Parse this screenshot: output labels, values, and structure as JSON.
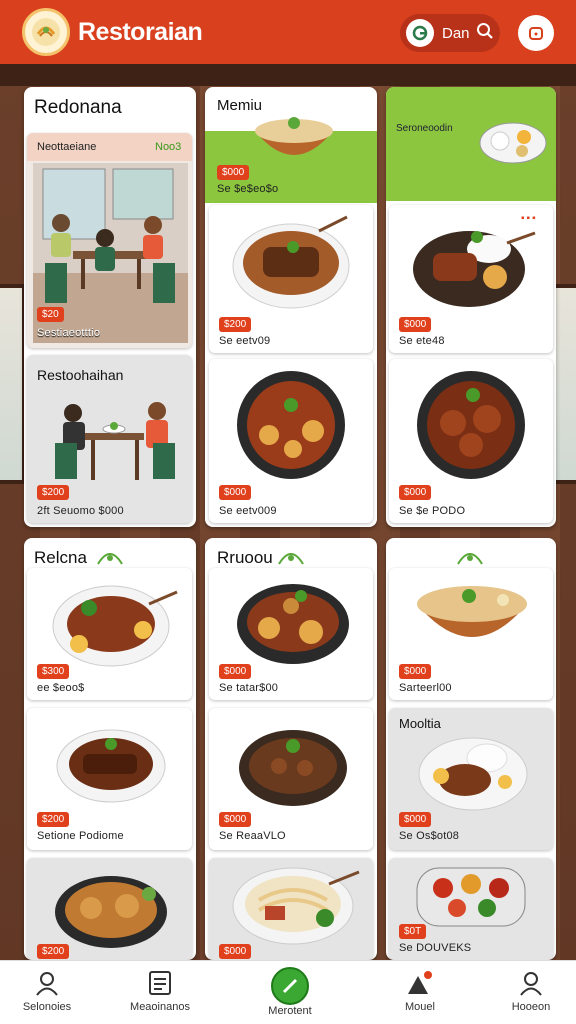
{
  "header": {
    "title": "Restoraian",
    "search_text": "Dan",
    "logo_icon": "food-plate-logo",
    "brand_color": "#d9401e"
  },
  "panels": {
    "p1": {
      "title": "Redonana",
      "banner_title": "Neottaeiane",
      "banner_tag": "Noo3",
      "scene_price": "$20",
      "scene_caption": "Sestiaeotttio",
      "scene2_title": "Restoohaihan",
      "scene2_price": "$200",
      "scene2_caption": "2ft Seuomo $000"
    },
    "p2": {
      "title": "Memiu",
      "top_price": "$000",
      "top_caption": "Se $e$eo$o",
      "mid_price": "$200",
      "mid_caption": "Se eetv09",
      "low_price": "$000",
      "low_caption": "Se eetv009"
    },
    "p3": {
      "band_title": "Seroneoodin",
      "mid_price": "$000",
      "mid_caption": "Se ete48",
      "low_price": "$000",
      "low_caption": "Se $e PODO"
    },
    "p4": {
      "title": "Relcna",
      "c1_price": "$300",
      "c1_caption": "ee $eoo$",
      "c2_price": "$200",
      "c2_caption": "Setione Podiome",
      "c3_price": "$200"
    },
    "p5": {
      "title": "Rruoou",
      "c1_price": "$000",
      "c1_caption": "Se tatar$00",
      "c2_price": "$000",
      "c2_caption": "Se ReaaVLO",
      "c3_price": "$000"
    },
    "p6": {
      "c1_price": "$000",
      "c1_caption": "Sarteerl00",
      "c2_title": "Mooltia",
      "c2_price": "$000",
      "c2_caption": "Se Os$ot08",
      "c3_price": "$0T",
      "c3_caption": "Se DOUVEKS"
    }
  },
  "bottom_nav": [
    {
      "label": "Selonoies",
      "icon": "user-icon"
    },
    {
      "label": "Meaoinanos",
      "icon": "menu-list-icon"
    },
    {
      "label": "Merotent",
      "icon": "pencil-icon"
    },
    {
      "label": "Mouel",
      "icon": "mountain-badge-icon"
    },
    {
      "label": "Hooeon",
      "icon": "profile-icon"
    }
  ],
  "colors": {
    "accent_red": "#e0401c",
    "accent_green": "#8cc63f",
    "nav_active_green": "#3aa832"
  }
}
